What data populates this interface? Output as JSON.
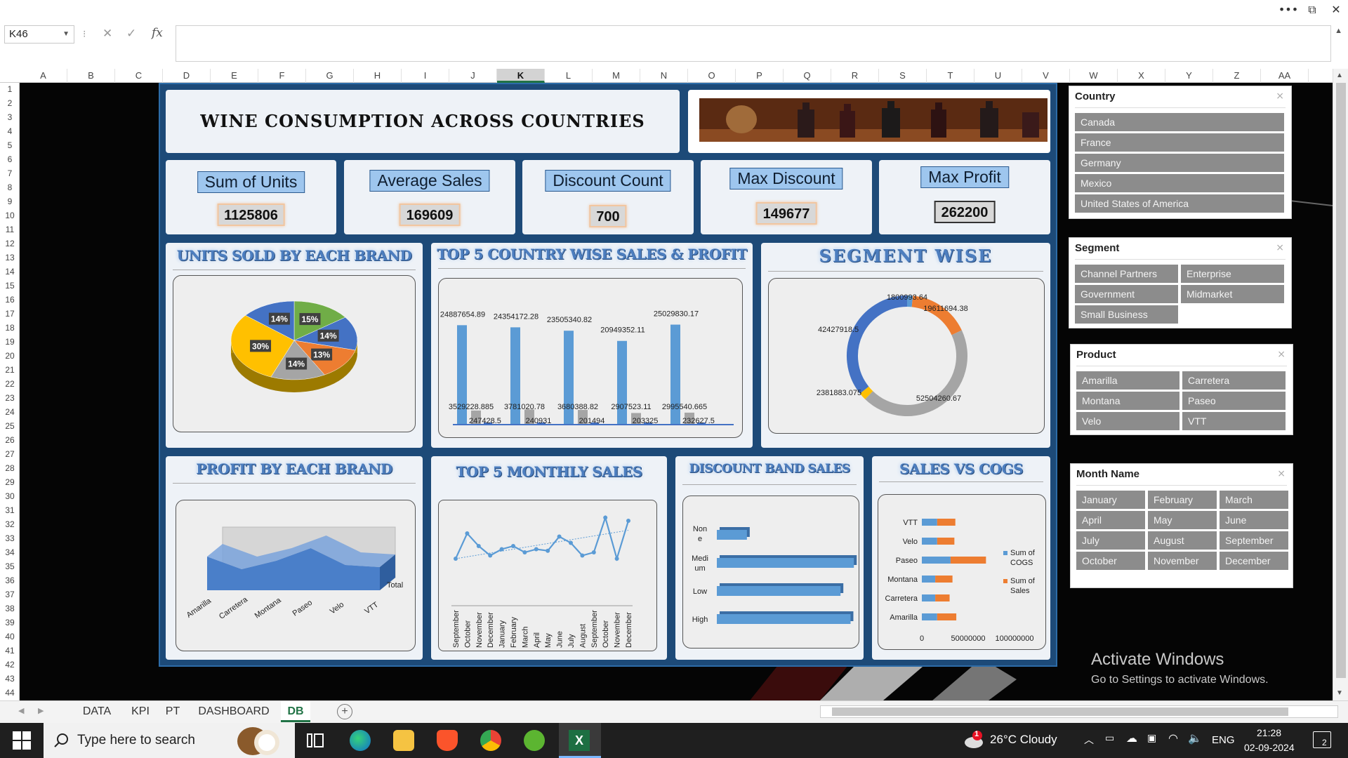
{
  "window": {
    "more_label": "•••",
    "restore_label": "⧉",
    "close_label": "✕"
  },
  "formula_bar": {
    "name_box": "K46",
    "cancel": "✕",
    "enter": "✓",
    "fx": "fx",
    "formula": ""
  },
  "columns": [
    "A",
    "B",
    "C",
    "D",
    "E",
    "F",
    "G",
    "H",
    "I",
    "J",
    "K",
    "L",
    "M",
    "N",
    "O",
    "P",
    "Q",
    "R",
    "S",
    "T",
    "U",
    "V",
    "W",
    "X",
    "Y",
    "Z",
    "AA"
  ],
  "selected_column": "K",
  "rows": [
    "1",
    "2",
    "3",
    "4",
    "5",
    "6",
    "7",
    "8",
    "9",
    "10",
    "11",
    "12",
    "13",
    "14",
    "15",
    "16",
    "17",
    "18",
    "19",
    "20",
    "21",
    "22",
    "23",
    "24",
    "25",
    "26",
    "27",
    "28",
    "29",
    "30",
    "31",
    "32",
    "33",
    "34",
    "35",
    "36",
    "37",
    "38",
    "39",
    "40",
    "41",
    "42",
    "43",
    "44"
  ],
  "dashboard": {
    "title": "WINE CONSUMPTION ACROSS COUNTRIES",
    "kpis": [
      {
        "label": "Sum of Units",
        "value": "1125806"
      },
      {
        "label": "Average Sales",
        "value": "169609"
      },
      {
        "label": "Discount Count",
        "value": "700"
      },
      {
        "label": "Max Discount",
        "value": "149677"
      },
      {
        "label": "Max Profit",
        "value": "262200"
      }
    ],
    "chart_titles": {
      "units_by_brand": "UNITS SOLD BY EACH BRAND",
      "top5_country": "TOP 5 COUNTRY WISE SALES & PROFIT",
      "segment": "SEGMENT WISE",
      "profit_by_brand": "PROFIT BY EACH BRAND",
      "monthly": "TOP 5 MONTHLY SALES",
      "discount_band": "DISCOUNT BAND SALES",
      "sales_vs_cogs": "SALES VS COGS"
    }
  },
  "chart_data": [
    {
      "type": "pie",
      "id": "units_by_brand",
      "values": [
        15,
        14,
        13,
        14,
        30,
        14
      ],
      "labels": [
        "15%",
        "14%",
        "13%",
        "14%",
        "30%",
        "14%"
      ],
      "colors": [
        "#70ad47",
        "#4472c4",
        "#ed7d31",
        "#a5a5a5",
        "#ffc000",
        "#4472c4"
      ]
    },
    {
      "type": "bar",
      "id": "top5_country",
      "series": [
        {
          "values": [
            24887654.89,
            24354172.28,
            23505340.82,
            20949352.11,
            25029830.17
          ],
          "labels": [
            "24887654.89",
            "24354172.28",
            "23505340.82",
            "20949352.11",
            "25029830.17"
          ],
          "color": "#5b9bd5"
        },
        {
          "values": [
            3529228.885,
            3781020.78,
            3680388.82,
            2907523.11,
            2995540.665
          ],
          "labels": [
            "3529228.885",
            "3781020.78",
            "3680388.82",
            "2907523.11",
            "2995540.665"
          ],
          "color": "#a5a5a5"
        },
        {
          "values": [
            247428.5,
            240931,
            201494,
            203325,
            232627.5
          ],
          "labels": [
            "247428.5",
            "240931",
            "201494",
            "203325",
            "232627.5"
          ],
          "color": "#4472c4"
        }
      ],
      "ylim": [
        0,
        26000000
      ]
    },
    {
      "type": "pie",
      "id": "segment",
      "values": [
        1800993.64,
        19611694.38,
        52504260.67,
        2381883.075,
        42427918.5
      ],
      "labels": [
        "1800993.64",
        "19611694.38",
        "52504260.67",
        "2381883.075",
        "42427918.5"
      ],
      "colors": [
        "#5b9bd5",
        "#ed7d31",
        "#a5a5a5",
        "#ffc000",
        "#4472c4"
      ]
    },
    {
      "type": "area",
      "id": "profit_by_brand",
      "categories": [
        "Amarilla",
        "Carretera",
        "Montana",
        "Paseo",
        "Velo",
        "VTT"
      ],
      "series": [
        {
          "name": "Total",
          "values": [
            0.8,
            0.5,
            0.7,
            1.0,
            0.6,
            0.55
          ]
        }
      ]
    },
    {
      "type": "line",
      "id": "monthly",
      "categories": [
        "September",
        "October",
        "November",
        "December",
        "January",
        "February",
        "March",
        "April",
        "May",
        "June",
        "July",
        "August",
        "September",
        "October",
        "November",
        "December"
      ],
      "values": [
        12,
        28,
        20,
        14,
        18,
        20,
        16,
        18,
        17,
        26,
        22,
        14,
        16,
        38,
        12,
        36
      ]
    },
    {
      "type": "bar",
      "id": "discount_band",
      "orientation": "horizontal",
      "categories": [
        "None",
        "Medium",
        "Low",
        "High"
      ],
      "values": [
        9,
        41,
        37,
        40
      ],
      "color": "#5b9bd5"
    },
    {
      "type": "bar",
      "id": "sales_vs_cogs",
      "orientation": "horizontal",
      "stacked": true,
      "categories": [
        "VTT",
        "Velo",
        "Paseo",
        "Montana",
        "Carretera",
        "Amarilla"
      ],
      "series": [
        {
          "name": "Sum of COGS",
          "values": [
            16000000,
            16000000,
            30000000,
            14000000,
            14000000,
            16000000
          ],
          "color": "#5b9bd5"
        },
        {
          "name": "Sum of Sales",
          "values": [
            19000000,
            18000000,
            37000000,
            18000000,
            15000000,
            20000000
          ],
          "color": "#ed7d31"
        }
      ],
      "xticks": [
        "0",
        "50000000",
        "100000000"
      ],
      "xlim": [
        0,
        110000000
      ]
    }
  ],
  "slicers": {
    "country": {
      "title": "Country",
      "items": [
        "Canada",
        "France",
        "Germany",
        "Mexico",
        "United States of America"
      ]
    },
    "segment": {
      "title": "Segment",
      "items": [
        "Channel Partners",
        "Enterprise",
        "Government",
        "Midmarket",
        "Small Business"
      ]
    },
    "product": {
      "title": "Product",
      "items": [
        "Amarilla",
        "Carretera",
        "Montana",
        "Paseo",
        "Velo",
        "VTT"
      ]
    },
    "month": {
      "title": "Month Name",
      "items": [
        "January",
        "February",
        "March",
        "April",
        "May",
        "June",
        "July",
        "August",
        "September",
        "October",
        "November",
        "December"
      ]
    }
  },
  "sheet_tabs": [
    "DATA",
    "KPI",
    "PT",
    "DASHBOARD",
    "DB"
  ],
  "active_tab": "DB",
  "activation": {
    "title": "Activate Windows",
    "subtitle": "Go to Settings to activate Windows."
  },
  "taskbar": {
    "search_placeholder": "Type here to search",
    "weather": "26°C  Cloudy",
    "lang": "ENG",
    "time": "21:28",
    "date": "02-09-2024",
    "notif_count": "2",
    "weather_badge": "1"
  }
}
